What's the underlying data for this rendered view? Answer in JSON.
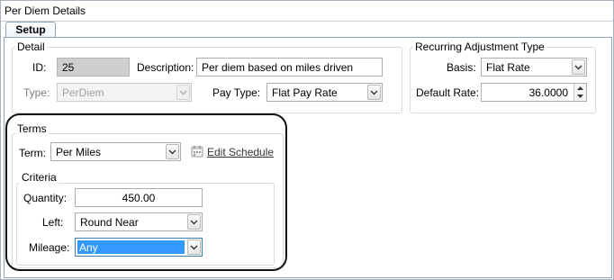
{
  "window": {
    "title": "Per Diem Details"
  },
  "tabs": [
    {
      "label": "Setup"
    }
  ],
  "detail": {
    "legend": "Detail",
    "id_label": "ID:",
    "id_value": "25",
    "description_label": "Description:",
    "description_value": "Per diem based on miles driven",
    "type_label": "Type:",
    "type_value": "PerDiem",
    "pay_type_label": "Pay Type:",
    "pay_type_value": "Flat Pay Rate"
  },
  "recurring": {
    "legend": "Recurring Adjustment Type",
    "basis_label": "Basis:",
    "basis_value": "Flat Rate",
    "default_rate_label": "Default Rate:",
    "default_rate_value": "36.0000"
  },
  "terms": {
    "legend": "Terms",
    "term_label": "Term:",
    "term_value": "Per Miles",
    "edit_schedule_label": "Edit Schedule",
    "edit_schedule_icon": "calendar-icon"
  },
  "criteria": {
    "legend": "Criteria",
    "quantity_label": "Quantity:",
    "quantity_value": "450.00",
    "left_label": "Left:",
    "left_value": "Round Near",
    "mileage_label": "Mileage:",
    "mileage_value": "Any"
  },
  "colors": {
    "selection": "#3399ff",
    "readonly_field": "#cfcfcf",
    "callout_ring": "#111111"
  }
}
